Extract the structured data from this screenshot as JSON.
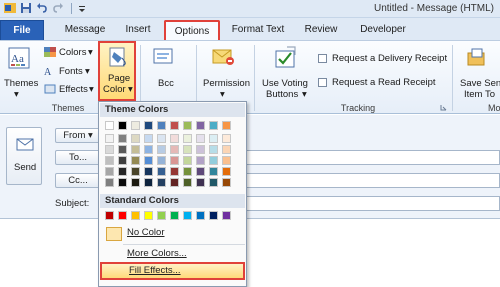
{
  "window": {
    "title": "Untitled - Message (HTML)"
  },
  "qat": {
    "icons": [
      "outlook-icon",
      "save-icon",
      "undo-icon",
      "redo-icon",
      "customize-icon"
    ]
  },
  "tabs": [
    {
      "label": "File"
    },
    {
      "label": "Message"
    },
    {
      "label": "Insert"
    },
    {
      "label": "Options"
    },
    {
      "label": "Format Text"
    },
    {
      "label": "Review"
    },
    {
      "label": "Developer"
    }
  ],
  "ribbon": {
    "themes_group": {
      "label": "Themes",
      "themes_button": "Themes",
      "colors": "Colors",
      "fonts": "Fonts",
      "effects": "Effects",
      "page_color_line1": "Page",
      "page_color_line2": "Color",
      "dropdown_arrow": "▾"
    },
    "bcc": "Bcc",
    "permission": "Permission",
    "tracking_group": {
      "label": "Tracking",
      "voting_line1": "Use Voting",
      "voting_line2": "Buttons",
      "delivery_receipt": "Request a Delivery Receipt",
      "read_receipt": "Request a Read Receipt"
    },
    "more_group": {
      "save_line1": "Save Sen",
      "save_line2": "Item To",
      "label": "Mo"
    }
  },
  "compose": {
    "send": "Send",
    "from": "From",
    "to": "To...",
    "cc": "Cc...",
    "subject": "Subject:"
  },
  "page_color_menu": {
    "theme_header": "Theme Colors",
    "standard_header": "Standard Colors",
    "no_color": "No Color",
    "more_colors": "More Colors...",
    "fill_effects": "Fill Effects...",
    "theme_columns": [
      [
        "#ffffff",
        "#f2f2f2",
        "#d9d9d9",
        "#bfbfbf",
        "#a6a6a6",
        "#7f7f7f"
      ],
      [
        "#000000",
        "#7f7f7f",
        "#595959",
        "#3f3f3f",
        "#262626",
        "#0d0d0d"
      ],
      [
        "#eeece1",
        "#ddd9c3",
        "#c4bd97",
        "#948a54",
        "#4a452a",
        "#1d1b10"
      ],
      [
        "#1f497d",
        "#c6d9f0",
        "#8db3e2",
        "#548dd4",
        "#17365d",
        "#0f243e"
      ],
      [
        "#4f81bd",
        "#dbe5f1",
        "#b8cce4",
        "#95b3d7",
        "#366092",
        "#244061"
      ],
      [
        "#c0504d",
        "#f2dcdb",
        "#e5b9b7",
        "#d99694",
        "#953734",
        "#632423"
      ],
      [
        "#9bbb59",
        "#ebf1dd",
        "#d7e3bc",
        "#c3d69b",
        "#76923c",
        "#4f6128"
      ],
      [
        "#8064a2",
        "#e5e0ec",
        "#ccc1d9",
        "#b2a2c7",
        "#5f497a",
        "#3f3151"
      ],
      [
        "#4bacc6",
        "#dbeef3",
        "#b7dde8",
        "#92cddc",
        "#31859b",
        "#205867"
      ],
      [
        "#f79646",
        "#fdeada",
        "#fbd5b5",
        "#fac08f",
        "#e36c09",
        "#974806"
      ]
    ],
    "standard_colors": [
      "#c00000",
      "#ff0000",
      "#ffc000",
      "#ffff00",
      "#92d050",
      "#00b050",
      "#00b0f0",
      "#0070c0",
      "#002060",
      "#7030a0"
    ]
  }
}
